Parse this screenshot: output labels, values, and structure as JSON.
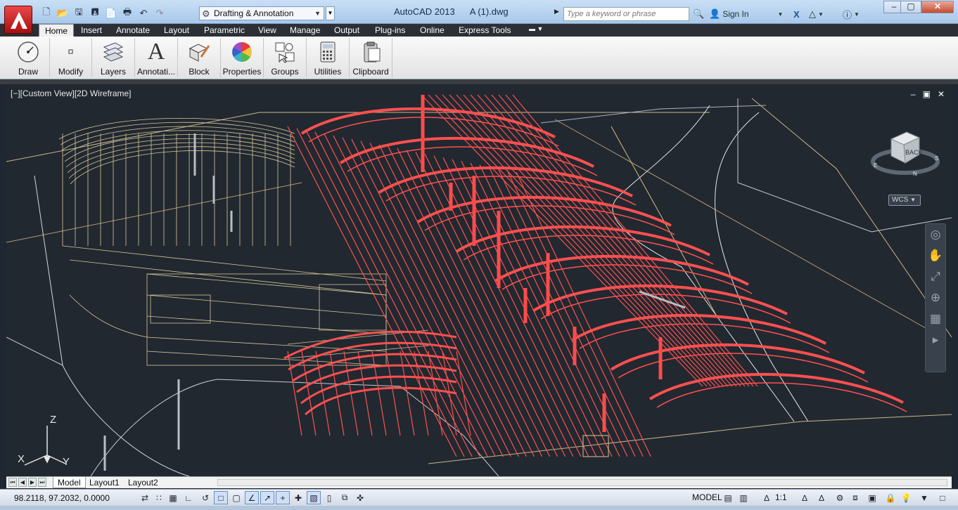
{
  "window": {
    "title": "AutoCAD 2013",
    "document": "A (1).dwg",
    "workspace": "Drafting & Annotation",
    "search_placeholder": "Type a keyword or phrase",
    "sign_in": "Sign In",
    "colors": {
      "titlebar": "#b5d0ee",
      "ribbon_dark": "#2c2f35",
      "viewport_bg": "#212830",
      "red_structure": "#ff4d4d",
      "tan_lines": "#d8c79a"
    },
    "icons": [
      "new-icon",
      "open-icon",
      "save-icon",
      "save-as-icon",
      "plot-icon",
      "undo-icon",
      "redo-icon",
      "exchange-icon",
      "binoculars-icon",
      "user-icon",
      "help-icon"
    ]
  },
  "ribbon": {
    "tabs": [
      "Home",
      "Insert",
      "Annotate",
      "Layout",
      "Parametric",
      "View",
      "Manage",
      "Output",
      "Plug-ins",
      "Online",
      "Express Tools"
    ],
    "active_tab": "Home",
    "panels": [
      "Draw",
      "Modify",
      "Layers",
      "Annotati...",
      "Block",
      "Properties",
      "Groups",
      "Utilities",
      "Clipboard"
    ]
  },
  "viewport": {
    "label": "[−][Custom View][2D Wireframe]",
    "viewcube_face": "BACK",
    "viewcube_compass": [
      "S",
      "E",
      "N"
    ],
    "wcs": "WCS",
    "ucs": {
      "x": "X",
      "y": "Y",
      "z": "Z"
    }
  },
  "layout_tabs": [
    "Model",
    "Layout1",
    "Layout2"
  ],
  "status": {
    "coordinates": "98.2118, 97.2032, 0.0000",
    "space": "MODEL",
    "annotation_scale": "1:1"
  }
}
